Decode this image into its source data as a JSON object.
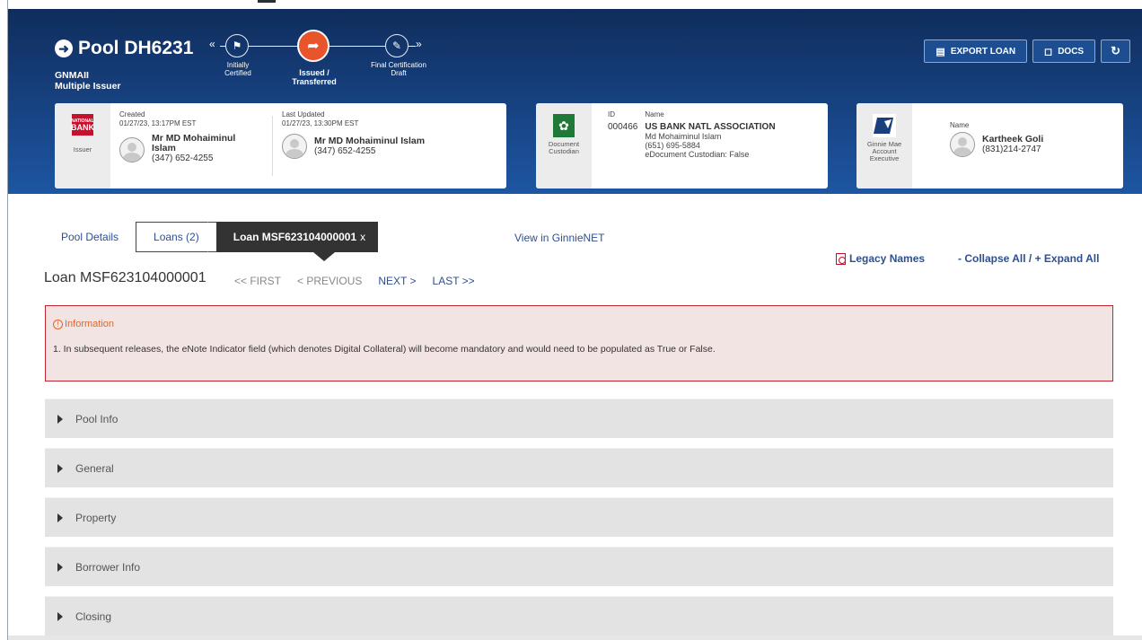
{
  "header": {
    "pool_title": "Pool DH6231",
    "pool_type": "GNMAII",
    "issuer_type": "Multiple Issuer",
    "steps": [
      {
        "label_line1": "Initially",
        "label_line2": "Certified"
      },
      {
        "label_line1": "Issued /",
        "label_line2": "Transferred"
      },
      {
        "label_line1": "Final Certification",
        "label_line2": "Draft"
      }
    ],
    "buttons": {
      "export": "EXPORT LOAN",
      "docs": "DOCS"
    }
  },
  "issuer_card": {
    "logo_line1": "NATIONAL",
    "logo_line2": "BANK",
    "side_label": "Issuer",
    "created": {
      "caption": "Created",
      "date": "01/27/23, 13:17PM EST",
      "name": "Mr MD Mohaiminul Islam",
      "phone": "(347) 652-4255"
    },
    "updated": {
      "caption": "Last Updated",
      "date": "01/27/23, 13:30PM EST",
      "name": "Mr MD Mohaiminul Islam",
      "phone": "(347) 652-4255"
    }
  },
  "custodian_card": {
    "side_label_1": "Document",
    "side_label_2": "Custodian",
    "id_caption": "ID",
    "id_value": "000466",
    "name_caption": "Name",
    "name_value": "US BANK NATL ASSOCIATION",
    "contact": "Md Mohaiminul Islam",
    "phone": "(651) 695-5884",
    "edoc": "eDocument Custodian: False"
  },
  "gme_card": {
    "side_label_1": "Ginnie Mae",
    "side_label_2": "Account",
    "side_label_3": "Executive",
    "name_caption": "Name",
    "name": "Kartheek Goli",
    "phone": "(831)214-2747"
  },
  "tabs": {
    "pool_details": "Pool Details",
    "loans": "Loans (2)",
    "active": "Loan MSF623104000001",
    "close": "x"
  },
  "links": {
    "view_ginnienet": "View in GinnieNET",
    "legacy_names": "Legacy Names",
    "collapse_expand": "- Collapse All / + Expand All"
  },
  "loan": {
    "title": "Loan MSF623104000001",
    "pager": {
      "first": "<< FIRST",
      "previous": "< PREVIOUS",
      "next": "NEXT >",
      "last": "LAST >>"
    }
  },
  "info": {
    "heading": "Information",
    "message": "1. In subsequent releases, the eNote Indicator field (which denotes Digital Collateral) will become mandatory and would need to be populated as True or False."
  },
  "sections": [
    "Pool Info",
    "General",
    "Property",
    "Borrower Info",
    "Closing"
  ]
}
